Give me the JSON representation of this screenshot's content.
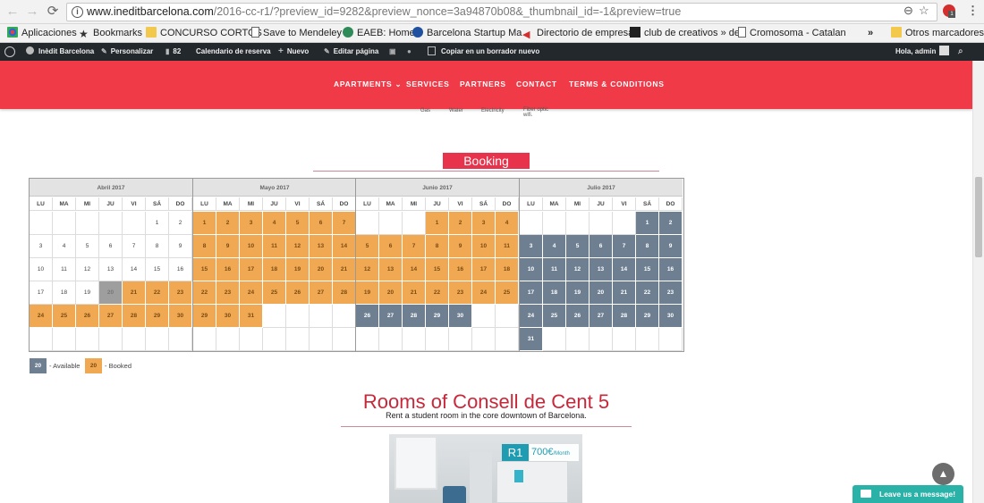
{
  "browser": {
    "url_host": "www.ineditbarcelona.com",
    "url_path": "/2016-cc-r1/?preview_id=9282&preview_nonce=3a94870b08&_thumbnail_id=-1&preview=true",
    "extension_badge": "1"
  },
  "bookmarks": {
    "items": [
      {
        "label": "Aplicaciones",
        "icon": "apps-grid-icon"
      },
      {
        "label": "Bookmarks",
        "icon": "star-icon"
      },
      {
        "label": "CONCURSO CORTOS",
        "icon": "folder-icon"
      },
      {
        "label": "Save to Mendeley",
        "icon": "page-icon"
      },
      {
        "label": "EAEB: Home",
        "icon": "globe-icon"
      },
      {
        "label": "Barcelona Startup Ma",
        "icon": "startup-icon"
      },
      {
        "label": "Directorio de empresa",
        "icon": "arrow-icon"
      },
      {
        "label": "club de creativos » de",
        "icon": "club-icon"
      },
      {
        "label": "Cromosoma - Catalan",
        "icon": "page-icon"
      }
    ],
    "overflow": "»",
    "other": "Otros marcadores"
  },
  "wp_admin_bar": {
    "site_name": "Inèdit Barcelona",
    "customize": "Personalizar",
    "comments_count": "82",
    "booking_calendar": "Calendario de reserva",
    "new": "Nuevo",
    "edit_page": "Editar página",
    "copy_draft": "Copiar en un borrador nuevo",
    "greeting": "Hola, admin"
  },
  "site_menu": {
    "items": [
      "APARTMENTS",
      "SERVICES",
      "PARTNERS",
      "CONTACT",
      "TERMS & CONDITIONS"
    ],
    "apartments_caret": "⌄"
  },
  "facilities": {
    "labels": [
      "Gas",
      "Water",
      "Electricity",
      "Fiber optic",
      "wifi."
    ]
  },
  "booking": {
    "title": "Booking",
    "next_arrow": "»",
    "weekdays": [
      "LU",
      "MA",
      "MI",
      "JU",
      "VI",
      "SÁ",
      "DO"
    ],
    "months": [
      {
        "name": "Abril 2017",
        "offset": 5,
        "days": 30,
        "statuses": "fffffffffffffffffffpbbbbbbbbbbb"
      },
      {
        "name": "Mayo 2017",
        "offset": 0,
        "days": 31,
        "statuses": "bbbbbbbbbbbbbbbbbbbbbbbbbbbbbbb"
      },
      {
        "name": "Junio 2017",
        "offset": 3,
        "days": 30,
        "statuses": "bbbbbbbbbbbbbbbbbbbbbbbbbaaaaa"
      },
      {
        "name": "Julio 2017",
        "offset": 5,
        "days": 31,
        "statuses": "aaaaaaaaaaaaaaaaaaaaaaaaaaaaaaa"
      }
    ],
    "legend": {
      "available_num": "20",
      "available_label": "- Available",
      "booked_num": "20",
      "booked_label": "- Booked"
    },
    "colors": {
      "booked": "#f0a952",
      "available": "#6e7f92",
      "past": "#9e9e9e"
    }
  },
  "rooms": {
    "title": "Rooms of Consell de Cent 5",
    "subtitle": "Rent a student room in the core downtown of Barcelona.",
    "price_code": "R1",
    "price_amount": "700€",
    "price_unit": "/Month"
  },
  "widgets": {
    "chat_label": "Leave us a message!",
    "scroll_top_icon": "▲"
  }
}
